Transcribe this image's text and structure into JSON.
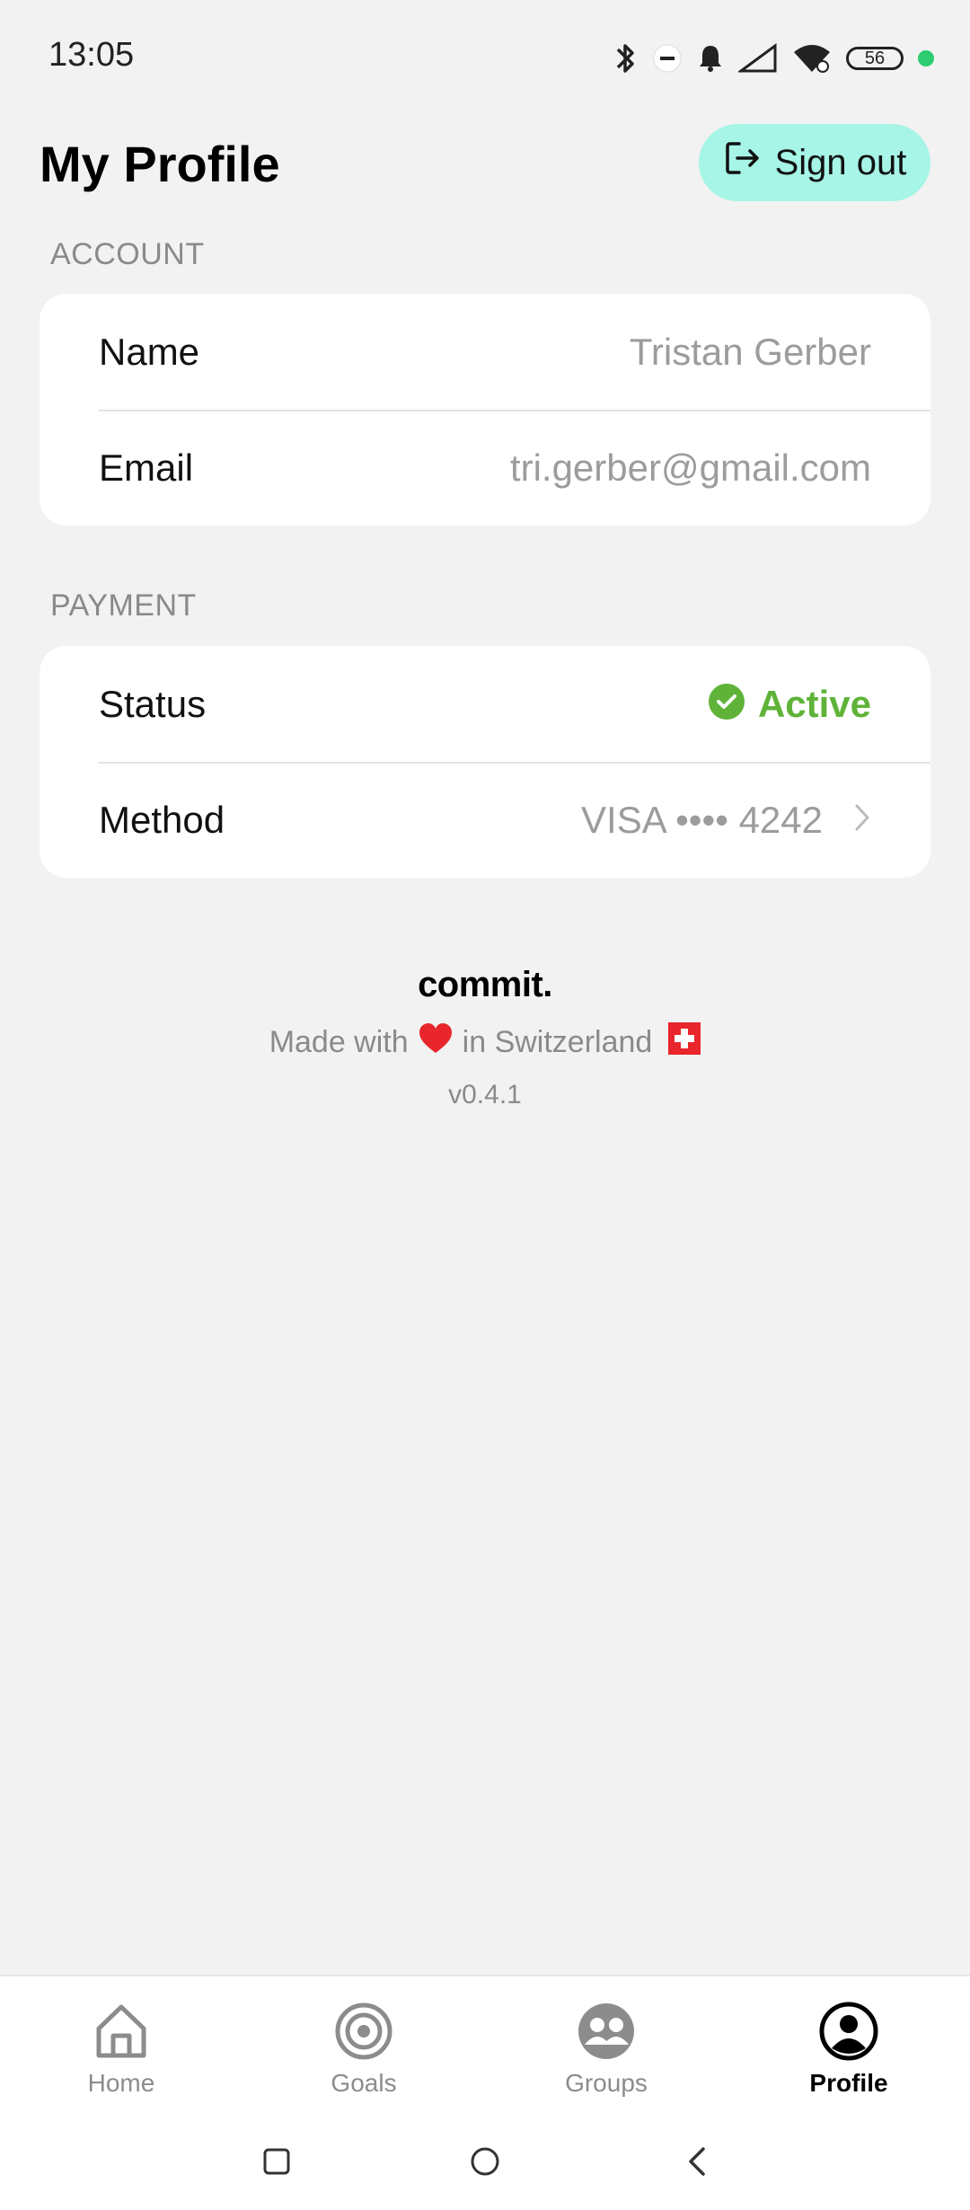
{
  "status_bar": {
    "time": "13:05",
    "battery": "56"
  },
  "header": {
    "title": "My Profile",
    "signout_label": "Sign out"
  },
  "account": {
    "section_label": "ACCOUNT",
    "rows": [
      {
        "label": "Name",
        "value": "Tristan Gerber"
      },
      {
        "label": "Email",
        "value": "tri.gerber@gmail.com"
      }
    ]
  },
  "payment": {
    "section_label": "PAYMENT",
    "status_label": "Status",
    "status_value": "Active",
    "method_label": "Method",
    "method_value": "VISA •••• 4242"
  },
  "footer": {
    "brand": "commit.",
    "made_with_prefix": "Made with",
    "made_with_suffix": "in Switzerland",
    "version": "v0.4.1"
  },
  "nav": {
    "items": [
      {
        "label": "Home",
        "icon": "home-icon"
      },
      {
        "label": "Goals",
        "icon": "target-icon"
      },
      {
        "label": "Groups",
        "icon": "group-icon"
      },
      {
        "label": "Profile",
        "icon": "profile-icon",
        "active": true
      }
    ]
  },
  "colors": {
    "accent": "#a6f5e6",
    "active_green": "#5fb338",
    "heart_red": "#e8262b"
  }
}
